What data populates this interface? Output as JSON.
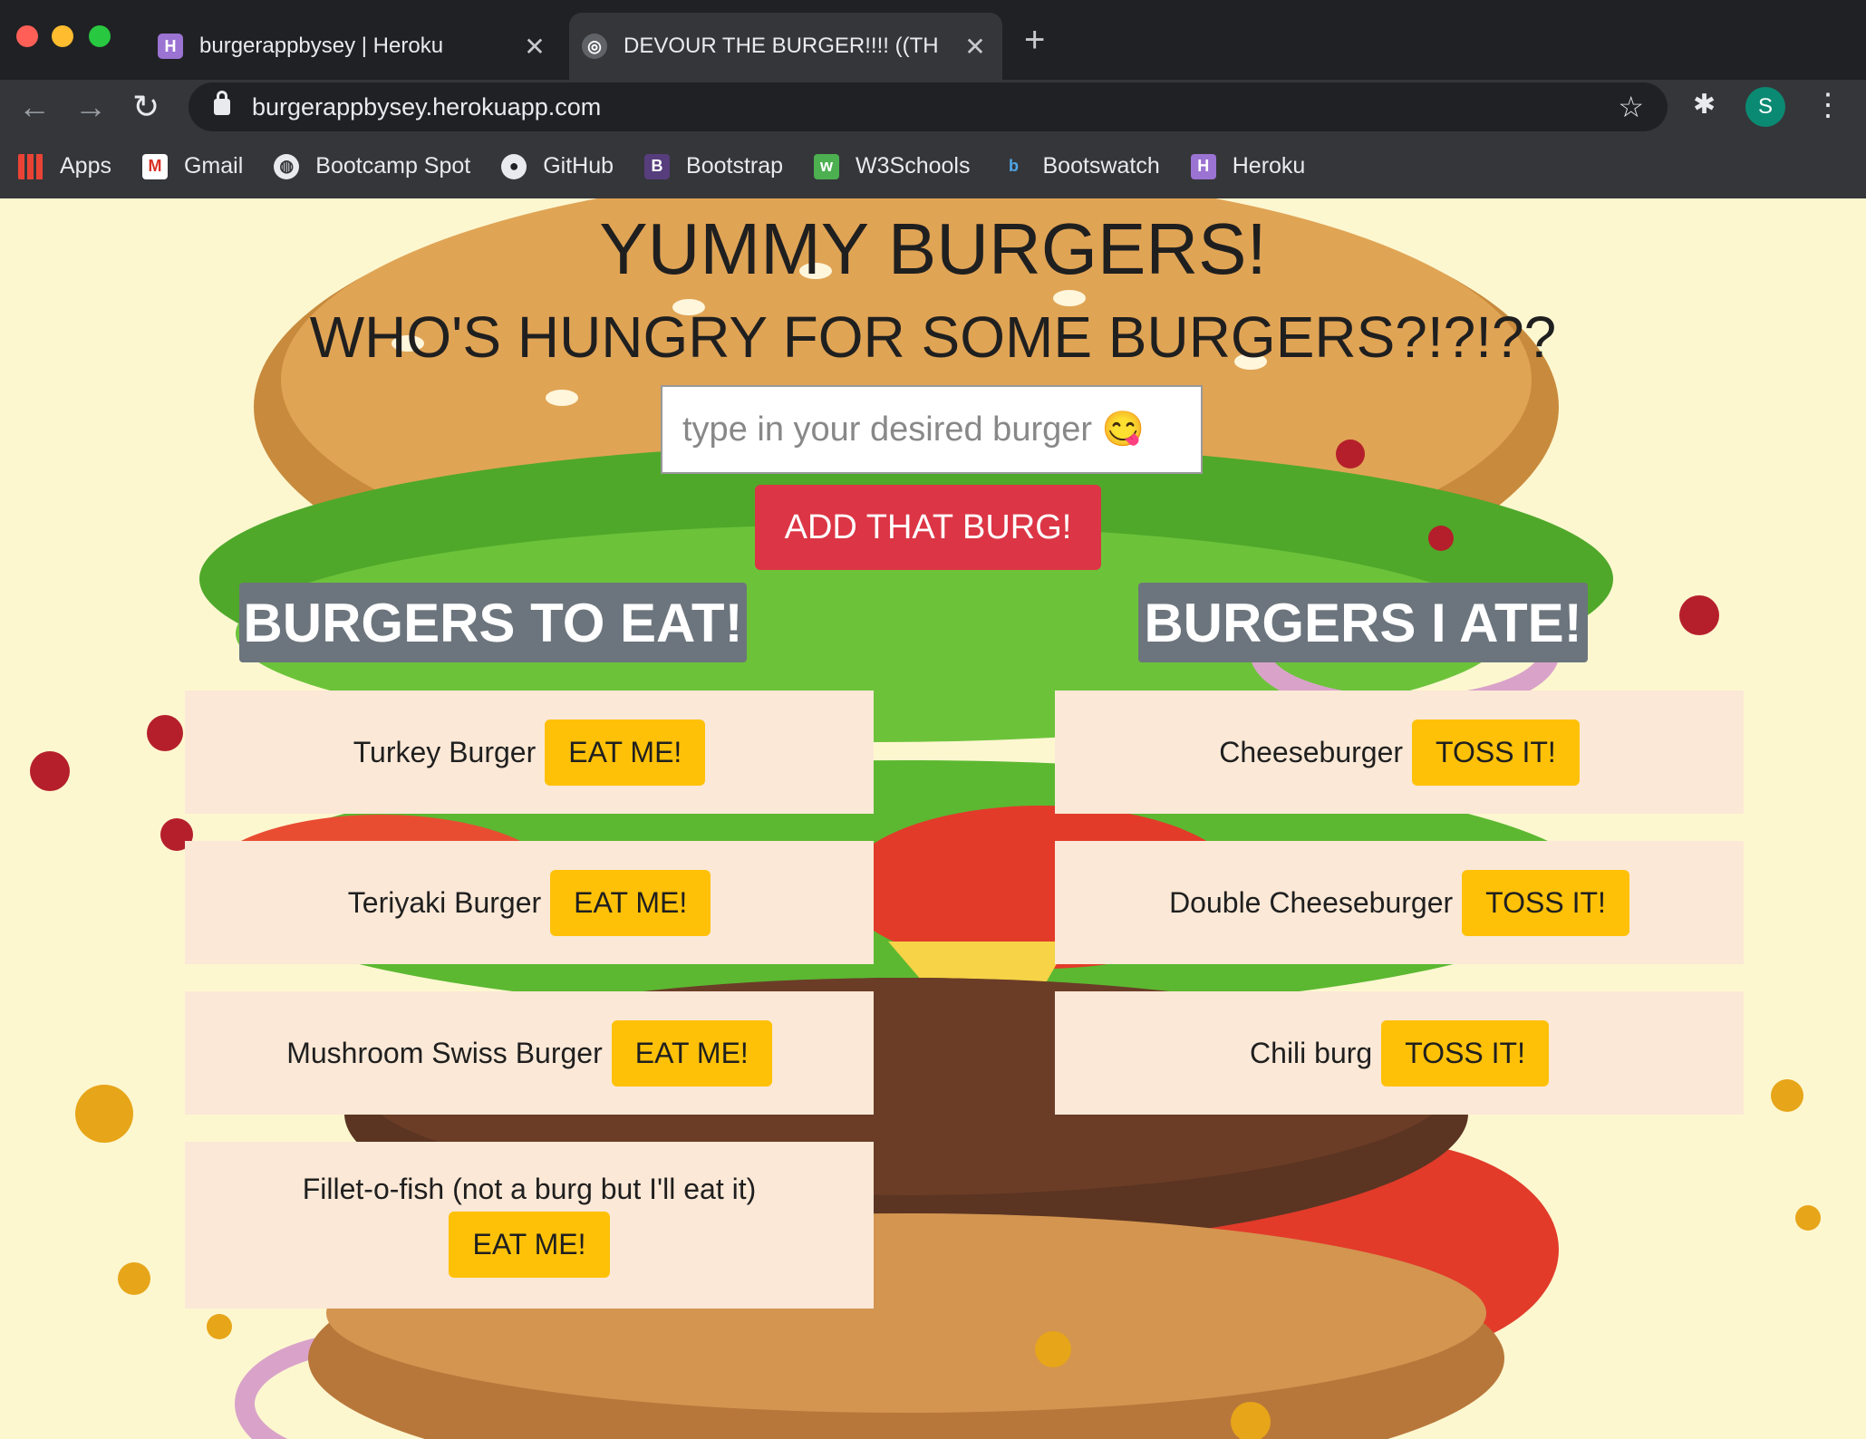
{
  "browser": {
    "tabs": [
      {
        "title": "burgerappbysey | Heroku",
        "favicon": "heroku-icon",
        "active": false
      },
      {
        "title": "DEVOUR THE BURGER!!!! ((TH",
        "favicon": "globe-icon",
        "active": true
      }
    ],
    "url": "burgerappbysey.herokuapp.com",
    "profile_initial": "S",
    "bookmarks": [
      {
        "label": "Apps",
        "icon": "apps-grid-icon"
      },
      {
        "label": "Gmail",
        "icon": "gmail-icon"
      },
      {
        "label": "Bootcamp Spot",
        "icon": "globe-icon"
      },
      {
        "label": "GitHub",
        "icon": "github-icon"
      },
      {
        "label": "Bootstrap",
        "icon": "bootstrap-icon"
      },
      {
        "label": "W3Schools",
        "icon": "w3schools-icon"
      },
      {
        "label": "Bootswatch",
        "icon": "bootswatch-icon"
      },
      {
        "label": "Heroku",
        "icon": "heroku-icon"
      }
    ]
  },
  "page": {
    "title": "YUMMY BURGERS!",
    "subtitle": "WHO'S HUNGRY FOR SOME BURGERS?!?!??",
    "input_placeholder": "type in your desired burger 😋",
    "add_button": "ADD THAT BURG!",
    "to_eat_header": "BURGERS TO EAT!",
    "ate_header": "BURGERS I ATE!",
    "to_eat": [
      {
        "name": "Turkey Burger",
        "button": "EAT ME!"
      },
      {
        "name": "Teriyaki Burger",
        "button": "EAT ME!"
      },
      {
        "name": "Mushroom Swiss Burger",
        "button": "EAT ME!"
      },
      {
        "name": "Fillet-o-fish (not a burg but I'll eat it)",
        "button": "EAT ME!"
      }
    ],
    "ate": [
      {
        "name": "Cheeseburger",
        "button": "TOSS IT!"
      },
      {
        "name": "Double Cheeseburger",
        "button": "TOSS IT!"
      },
      {
        "name": "Chili burg",
        "button": "TOSS IT!"
      }
    ]
  },
  "colors": {
    "page_bg": "#fdf7d0",
    "add_button": "#dc3545",
    "header_bg": "#6c757d",
    "card_bg": "#fbe8d6",
    "action_button": "#ffc107"
  }
}
